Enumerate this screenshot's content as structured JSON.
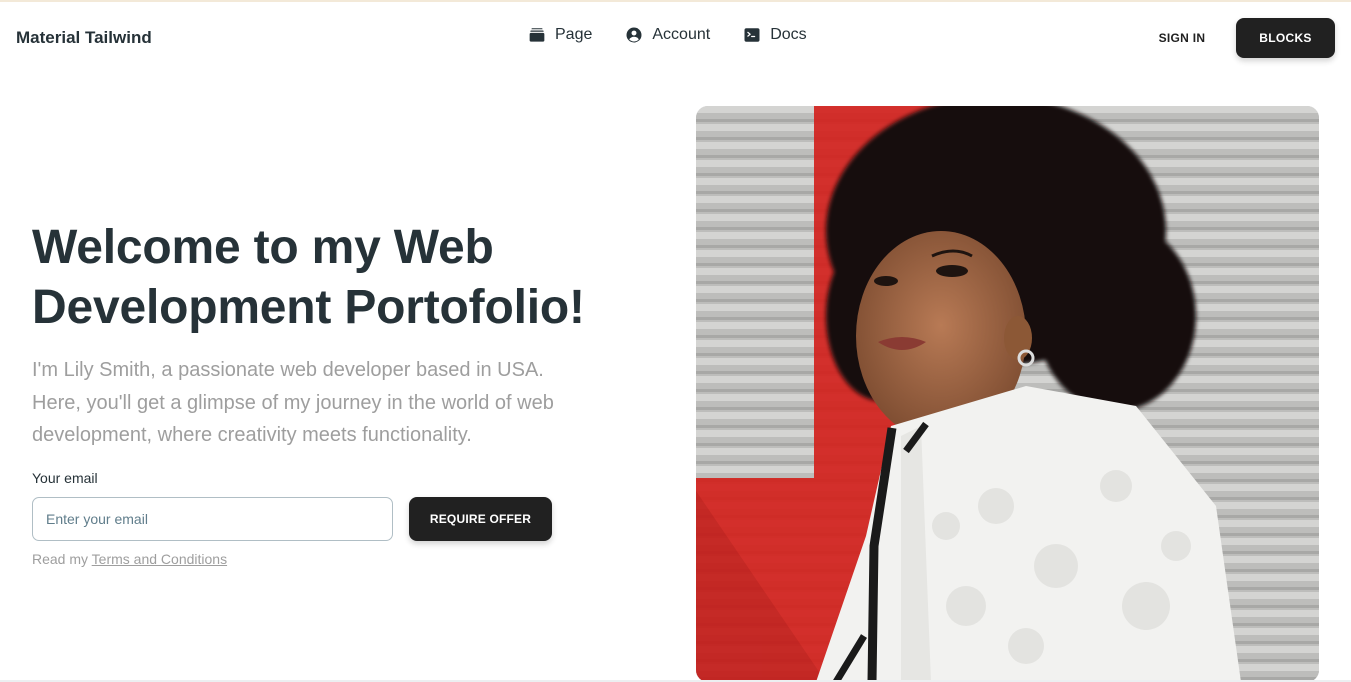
{
  "navbar": {
    "brand": "Material Tailwind",
    "links": [
      {
        "label": "Page",
        "icon": "rectangle-stack-icon"
      },
      {
        "label": "Account",
        "icon": "user-circle-icon"
      },
      {
        "label": "Docs",
        "icon": "command-line-icon"
      }
    ],
    "sign_in_label": "SIGN IN",
    "blocks_label": "BLOCKS"
  },
  "hero": {
    "title_line1": "Welcome to my Web",
    "title_line2": "Development Portofolio!",
    "description": "I'm Lily Smith, a passionate web developer based in USA. Here, you'll get a glimpse of my journey in the world of web development, where creativity meets functionality.",
    "email_label": "Your email",
    "email_placeholder": "Enter your email",
    "email_value": "",
    "offer_button": "REQUIRE OFFER",
    "terms_prefix": "Read my ",
    "terms_link": "Terms and Conditions"
  },
  "colors": {
    "accent_dark": "#212121",
    "text_primary": "#263238",
    "text_muted": "#9e9e9e",
    "image_red_wall": "#d71e1e"
  }
}
